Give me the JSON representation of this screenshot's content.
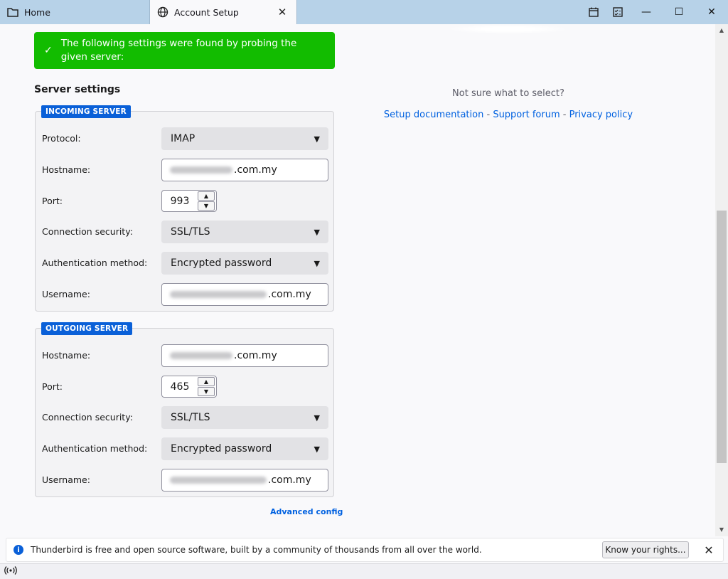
{
  "tabs": {
    "home_label": "Home",
    "active_label": "Account Setup",
    "close_glyph": "✕"
  },
  "window": {
    "minimize": "—",
    "maximize": "☐",
    "close": "✕"
  },
  "banner": {
    "text": "The following settings were found by probing the given server:",
    "color": "#12bc00"
  },
  "server_settings_title": "Server settings",
  "incoming": {
    "legend": "INCOMING SERVER",
    "protocol_label": "Protocol:",
    "protocol_value": "IMAP",
    "hostname_label": "Hostname:",
    "hostname_suffix": ".com.my",
    "port_label": "Port:",
    "port_value": "993",
    "security_label": "Connection security:",
    "security_value": "SSL/TLS",
    "auth_label": "Authentication method:",
    "auth_value": "Encrypted password",
    "username_label": "Username:",
    "username_suffix": ".com.my"
  },
  "outgoing": {
    "legend": "OUTGOING SERVER",
    "hostname_label": "Hostname:",
    "hostname_suffix": ".com.my",
    "port_label": "Port:",
    "port_value": "465",
    "security_label": "Connection security:",
    "security_value": "SSL/TLS",
    "auth_label": "Authentication method:",
    "auth_value": "Encrypted password",
    "username_label": "Username:",
    "username_suffix": ".com.my"
  },
  "help": {
    "question": "Not sure what to select?",
    "setup_doc": "Setup documentation",
    "support_forum": "Support forum",
    "privacy_policy": "Privacy policy",
    "separator": " - "
  },
  "advanced_config": "Advanced config",
  "notification": {
    "text": "Thunderbird is free and open source software, built by a community of thousands from all over the world.",
    "button": "Know your rights...",
    "close": "✕"
  },
  "accent_color": "#0a60d8",
  "link_color": "#0061e0"
}
